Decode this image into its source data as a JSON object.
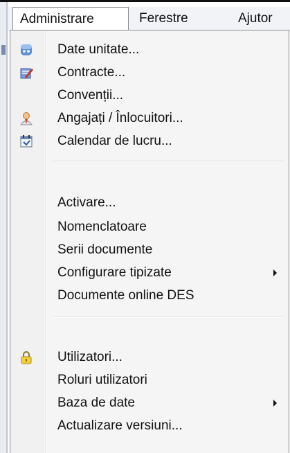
{
  "menubar": {
    "items": [
      {
        "label": "Administrare",
        "active": true
      },
      {
        "label": "Ferestre",
        "active": false
      },
      {
        "label": "Ajutor",
        "active": false
      }
    ]
  },
  "dropdown": {
    "items": [
      {
        "label": "Date unitate...",
        "icon": "company-icon"
      },
      {
        "label": "Contracte...",
        "icon": "contract-edit-icon"
      },
      {
        "label": "Convenții...",
        "icon": ""
      },
      {
        "label": "Angajați / Înlocuitori...",
        "icon": "employee-icon"
      },
      {
        "label": "Calendar de lucru...",
        "icon": "calendar-icon"
      },
      {
        "label": "Activare...",
        "icon": ""
      },
      {
        "label": "Nomenclatoare",
        "icon": ""
      },
      {
        "label": "Serii documente",
        "icon": ""
      },
      {
        "label": "Configurare tipizate",
        "icon": "",
        "submenu": true
      },
      {
        "label": "Documente online DES",
        "icon": ""
      },
      {
        "label": "Utilizatori...",
        "icon": "lock-icon"
      },
      {
        "label": "Roluri utilizatori",
        "icon": ""
      },
      {
        "label": "Baza de date",
        "icon": "",
        "submenu": true
      },
      {
        "label": "Actualizare versiuni...",
        "icon": ""
      }
    ]
  },
  "colors": {
    "menu_bg": "#f5f5f5",
    "gutter_bg": "#f1f1f1",
    "border": "#8a8a8a",
    "text": "#111111"
  }
}
